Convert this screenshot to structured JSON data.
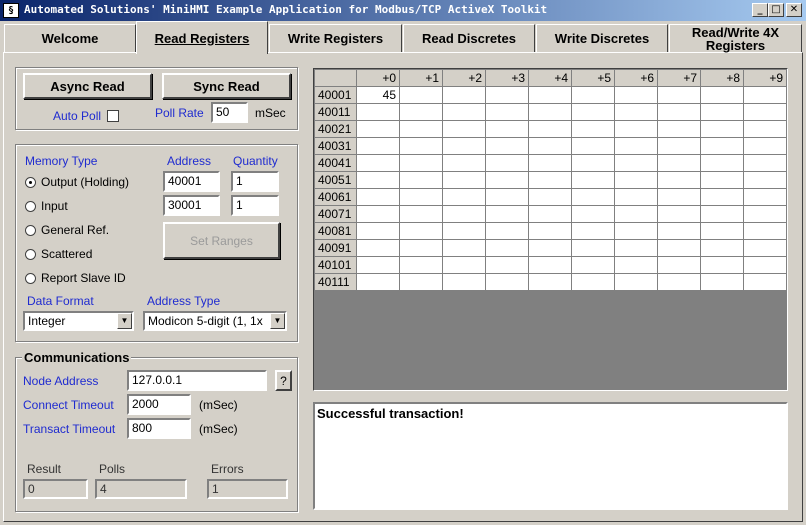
{
  "window": {
    "title": "Automated Solutions' MiniHMI Example Application for Modbus/TCP ActiveX Toolkit",
    "icon_glyph": "§",
    "minimize": "_",
    "maximize": "□",
    "close": "✕"
  },
  "tabs": [
    {
      "label": "Welcome"
    },
    {
      "label": "Read Registers",
      "active": true
    },
    {
      "label": "Write Registers"
    },
    {
      "label": "Read Discretes"
    },
    {
      "label": "Write Discretes"
    },
    {
      "label": "Read/Write 4X Registers"
    }
  ],
  "controls": {
    "async_read": "Async Read",
    "sync_read": "Sync Read",
    "auto_poll_label": "Auto Poll",
    "poll_rate_label": "Poll Rate",
    "poll_rate_value": "50",
    "poll_rate_unit": "mSec"
  },
  "memory": {
    "memory_type_label": "Memory Type",
    "address_label": "Address",
    "quantity_label": "Quantity",
    "options": [
      "Output (Holding)",
      "Input",
      "General Ref.",
      "Scattered",
      "Report Slave ID"
    ],
    "selected": "Output (Holding)",
    "address_1": "40001",
    "quantity_1": "1",
    "address_2": "30001",
    "quantity_2": "1",
    "set_ranges": "Set Ranges",
    "data_format_label": "Data Format",
    "data_format_value": "Integer",
    "address_type_label": "Address Type",
    "address_type_value": "Modicon 5-digit (1, 1x"
  },
  "comms": {
    "title": "Communications",
    "node_address_label": "Node Address",
    "node_address_value": "127.0.0.1",
    "help": "?",
    "connect_timeout_label": "Connect Timeout",
    "connect_timeout_value": "2000",
    "transact_timeout_label": "Transact Timeout",
    "transact_timeout_value": "800",
    "unit": "(mSec)",
    "result_label": "Result",
    "result_value": "0",
    "polls_label": "Polls",
    "polls_value": "4",
    "errors_label": "Errors",
    "errors_value": "1"
  },
  "grid": {
    "columns": [
      "+0",
      "+1",
      "+2",
      "+3",
      "+4",
      "+5",
      "+6",
      "+7",
      "+8",
      "+9"
    ],
    "rows": [
      {
        "addr": "40001",
        "cells": [
          "45",
          "",
          "",
          "",
          "",
          "",
          "",
          "",
          "",
          ""
        ]
      },
      {
        "addr": "40011",
        "cells": [
          "",
          "",
          "",
          "",
          "",
          "",
          "",
          "",
          "",
          ""
        ]
      },
      {
        "addr": "40021",
        "cells": [
          "",
          "",
          "",
          "",
          "",
          "",
          "",
          "",
          "",
          ""
        ]
      },
      {
        "addr": "40031",
        "cells": [
          "",
          "",
          "",
          "",
          "",
          "",
          "",
          "",
          "",
          ""
        ]
      },
      {
        "addr": "40041",
        "cells": [
          "",
          "",
          "",
          "",
          "",
          "",
          "",
          "",
          "",
          ""
        ]
      },
      {
        "addr": "40051",
        "cells": [
          "",
          "",
          "",
          "",
          "",
          "",
          "",
          "",
          "",
          ""
        ]
      },
      {
        "addr": "40061",
        "cells": [
          "",
          "",
          "",
          "",
          "",
          "",
          "",
          "",
          "",
          ""
        ]
      },
      {
        "addr": "40071",
        "cells": [
          "",
          "",
          "",
          "",
          "",
          "",
          "",
          "",
          "",
          ""
        ]
      },
      {
        "addr": "40081",
        "cells": [
          "",
          "",
          "",
          "",
          "",
          "",
          "",
          "",
          "",
          ""
        ]
      },
      {
        "addr": "40091",
        "cells": [
          "",
          "",
          "",
          "",
          "",
          "",
          "",
          "",
          "",
          ""
        ]
      },
      {
        "addr": "40101",
        "cells": [
          "",
          "",
          "",
          "",
          "",
          "",
          "",
          "",
          "",
          ""
        ]
      },
      {
        "addr": "40111",
        "cells": [
          "",
          "",
          "",
          "",
          "",
          "",
          "",
          "",
          "",
          ""
        ]
      }
    ]
  },
  "status": {
    "message": "Successful transaction!"
  },
  "colors": {
    "label_blue": "#1f2bd0",
    "face": "#d4d0c8",
    "titlebar_start": "#0a246a"
  }
}
